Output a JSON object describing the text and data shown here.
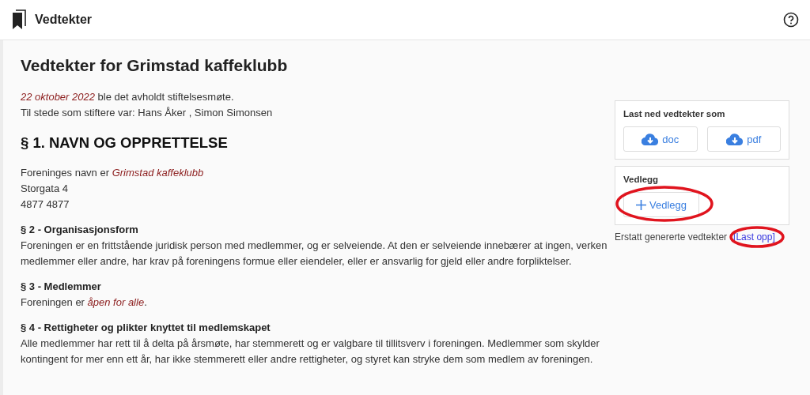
{
  "header": {
    "title": "Vedtekter"
  },
  "document": {
    "title": "Vedtekter for Grimstad kaffeklubb",
    "intro": [
      "*22 oktober 2022* ble det avholdt stiftelsesmøte.",
      "Til stede som stiftere var: Hans Åker , Simon Simonsen"
    ],
    "sections": [
      {
        "kind": "major",
        "heading": "§ 1. NAVN OG OPPRETTELSE",
        "lines": [
          "Foreninges navn er *Grimstad kaffeklubb*",
          "Storgata 4",
          "4877 4877"
        ]
      },
      {
        "kind": "minor",
        "heading": "§ 2 - Organisasjonsform",
        "lines": [
          "Foreningen er en frittstående juridisk person med medlemmer, og er selveiende. At den er selveiende innebærer at ingen, verken medlemmer eller andre, har krav på foreningens formue eller eiendeler, eller er ansvarlig for gjeld eller andre forpliktelser."
        ]
      },
      {
        "kind": "minor",
        "heading": "§ 3 - Medlemmer",
        "lines": [
          "Foreningen er *åpen for alle*."
        ]
      },
      {
        "kind": "minor",
        "heading": "§ 4 - Rettigheter og plikter knyttet til medlemskapet",
        "lines": [
          "Alle medlemmer har rett til å delta på årsmøte, har stemmerett og er valgbare til tillitsverv i foreningen. Medlemmer som skylder kontingent for mer enn ett år, har ikke stemmerett eller andre rettigheter, og styret kan stryke dem som medlem av foreningen."
        ]
      }
    ]
  },
  "download": {
    "title": "Last ned vedtekter som",
    "buttons": [
      {
        "label": "doc"
      },
      {
        "label": "pdf"
      }
    ]
  },
  "attachments": {
    "title": "Vedlegg",
    "button": {
      "label": "Vedlegg",
      "circled": true
    }
  },
  "replace": {
    "text": "Erstatt genererte vedtekter",
    "link": "[Last opp]",
    "circled": true
  }
}
